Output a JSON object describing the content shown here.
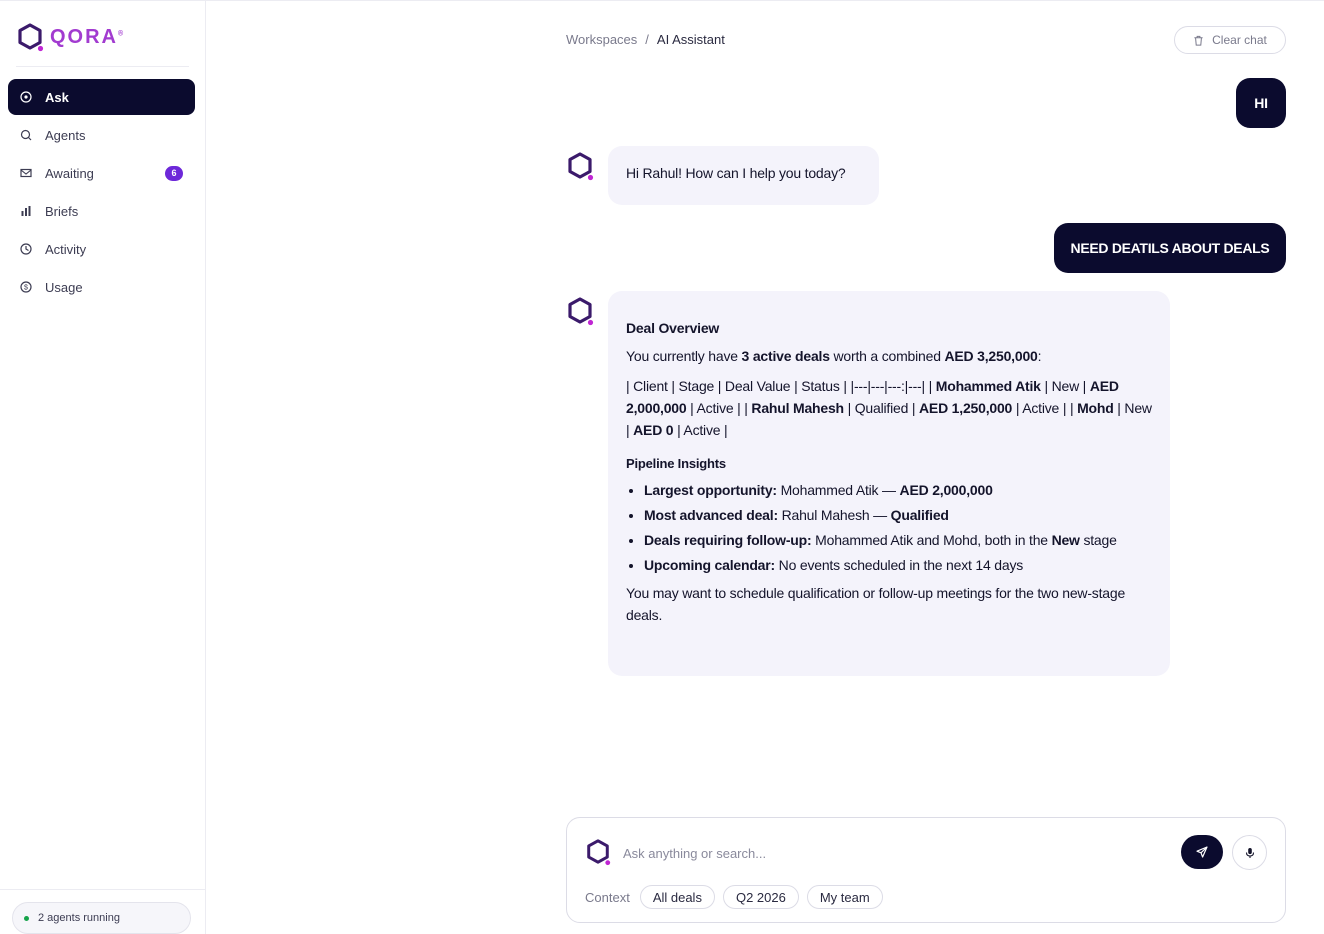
{
  "brand": {
    "name": "QORA",
    "mark": "®"
  },
  "sidebar": {
    "items": [
      {
        "label": "Ask",
        "icon": "compass-icon",
        "active": true
      },
      {
        "label": "Agents",
        "icon": "search-icon"
      },
      {
        "label": "Awaiting",
        "icon": "mail-icon",
        "badge": "6"
      },
      {
        "label": "Briefs",
        "icon": "bar-chart-icon"
      },
      {
        "label": "Activity",
        "icon": "clock-icon"
      },
      {
        "label": "Usage",
        "icon": "dollar-icon"
      }
    ],
    "status": "2 agents running"
  },
  "header": {
    "breadcrumb_root": "Workspaces",
    "breadcrumb_sep": "/",
    "breadcrumb_current": "AI Assistant",
    "clear_label": "Clear chat"
  },
  "messages": {
    "user1": "HI",
    "bot1": "Hi Rahul! How can I help you today?",
    "user2": "NEED DEATILS ABOUT DEALS",
    "bot2": {
      "title": "Deal Overview",
      "intro_a": "You currently have ",
      "intro_b": "3 active deals",
      "intro_c": " worth a combined ",
      "intro_d": "AED 3,250,000",
      "intro_e": ":",
      "t1": "| Client | Stage | Deal Value | Status | |---|---|---:|---| | ",
      "t2": "Mohammed Atik",
      "t3": " | New | ",
      "t4": "AED 2,000,000",
      "t5": " | Active | | ",
      "t6": "Rahul Mahesh",
      "t7": " | Qualified | ",
      "t8": "AED 1,250,000",
      "t9": " | Active | | ",
      "t10": "Mohd",
      "t11": " | New | ",
      "t12": "AED 0",
      "t13": " | Active |",
      "insights_title": "Pipeline Insights",
      "b1_label": "Largest opportunity:",
      "b1_text": " Mohammed Atik — ",
      "b1_value": "AED 2,000,000",
      "b2_label": "Most advanced deal:",
      "b2_text": " Rahul Mahesh — ",
      "b2_value": "Qualified",
      "b3_label": "Deals requiring follow-up:",
      "b3_text": " Mohammed Atik and Mohd, both in the ",
      "b3_value": "New",
      "b3_tail": " stage",
      "b4_label": "Upcoming calendar:",
      "b4_text": " No events scheduled in the next 14 days",
      "closing": "You may want to schedule qualification or follow-up meetings for the two new-stage deals."
    }
  },
  "composer": {
    "placeholder": "Ask anything or search...",
    "context_label": "Context",
    "chips": [
      "All deals",
      "Q2 2026",
      "My team"
    ]
  },
  "colors": {
    "primary": "#0b0b2e",
    "accent": "#6d28d9",
    "brand": "#a23bd0",
    "bubble": "#f4f3fb"
  }
}
